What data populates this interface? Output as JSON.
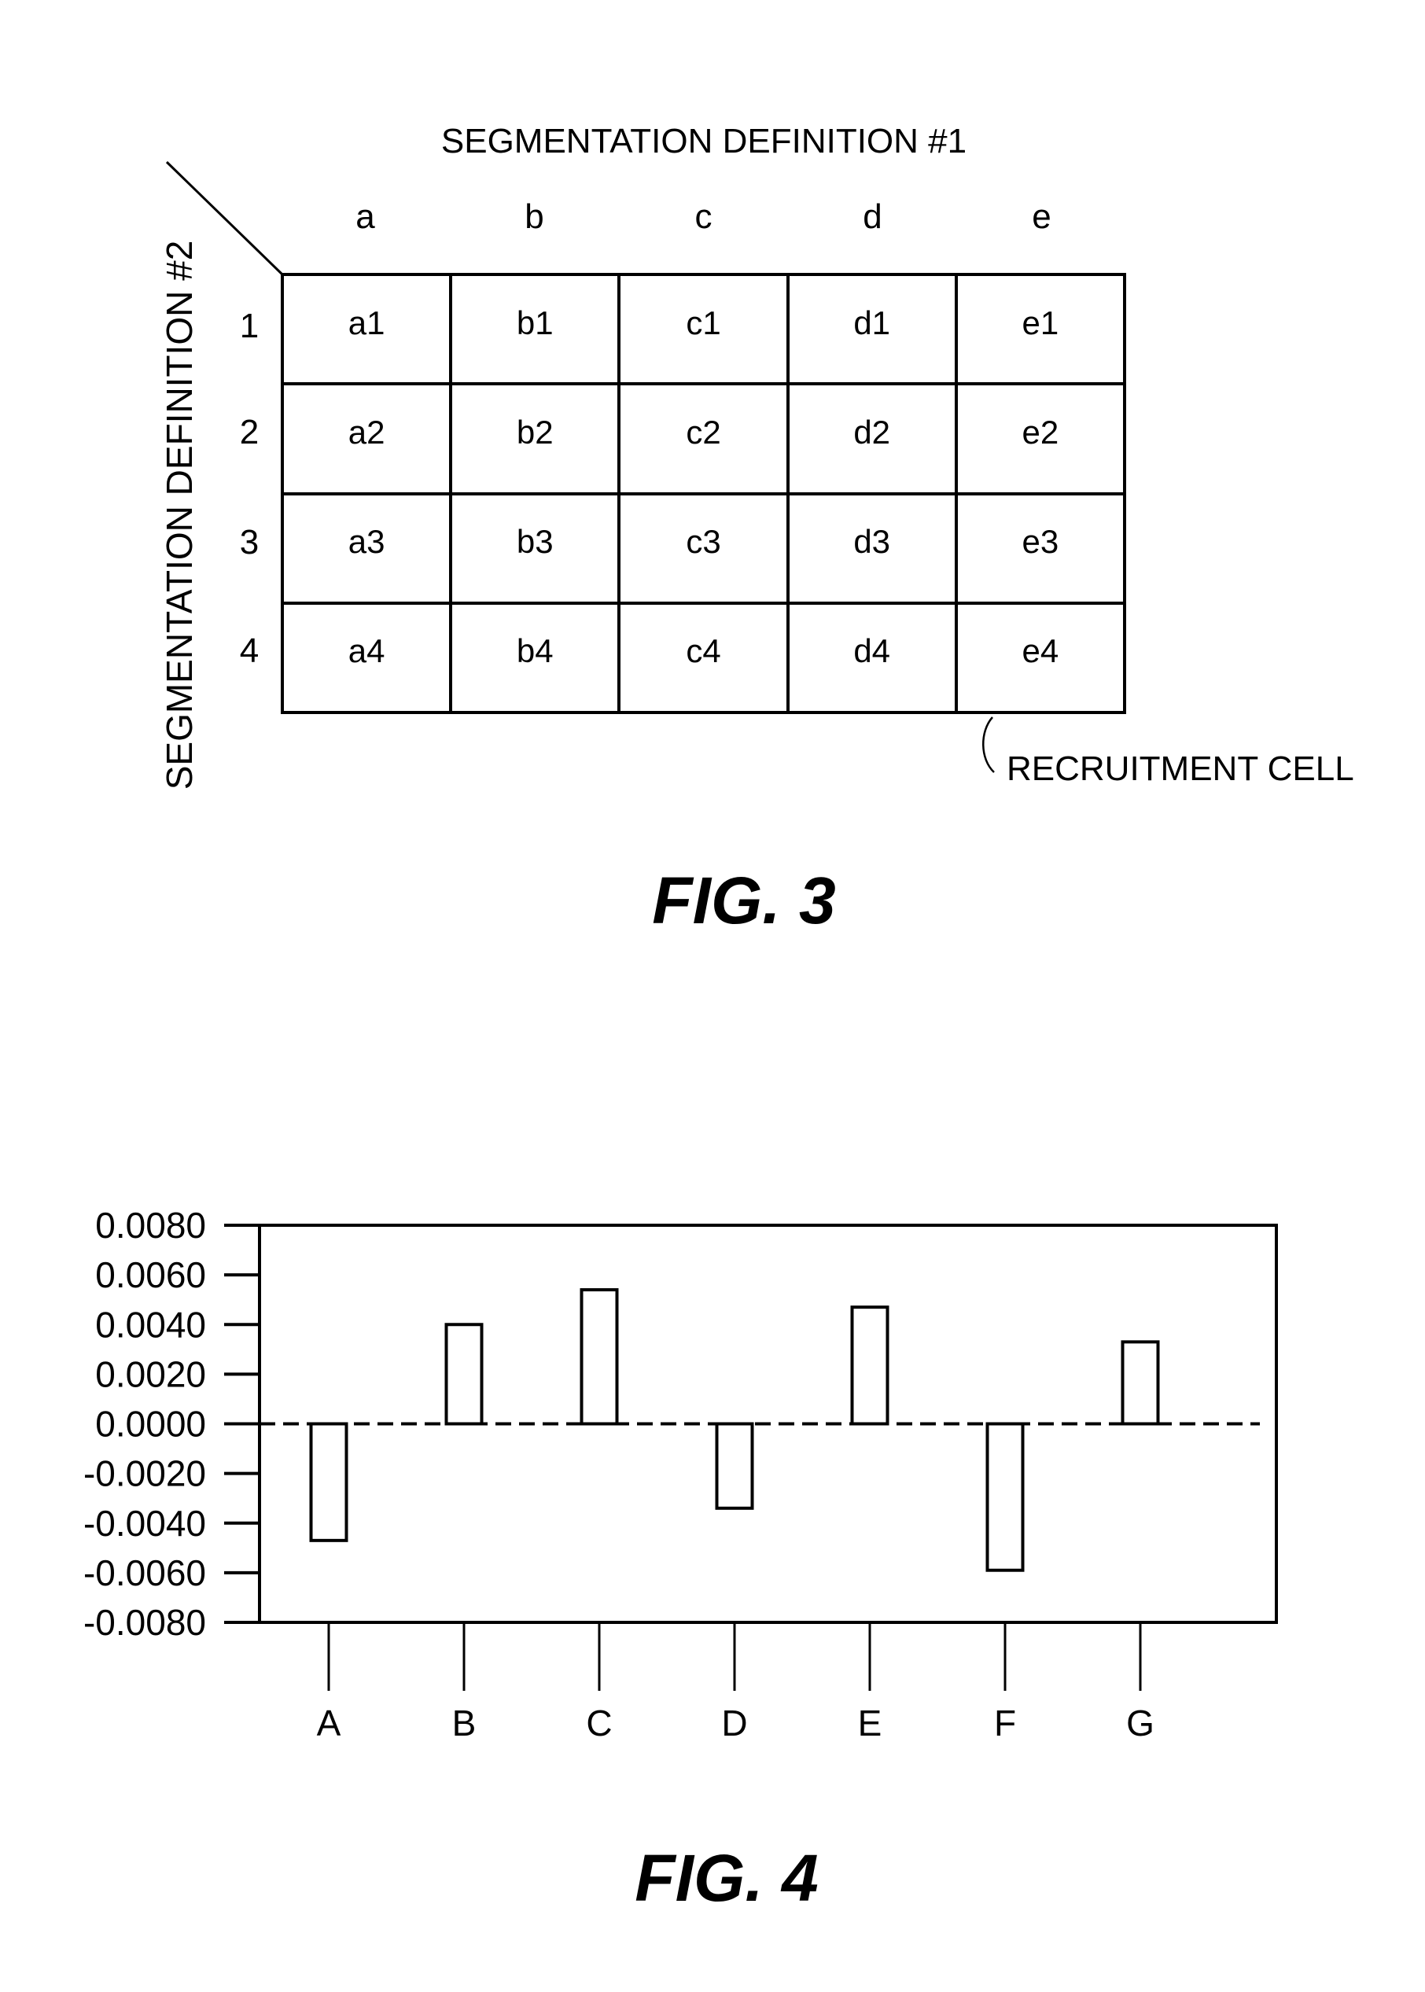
{
  "fig3": {
    "caption": "FIG. 3",
    "column_axis_title": "SEGMENTATION DEFINITION #1",
    "row_axis_title": "SEGMENTATION DEFINITION #2",
    "column_headers": [
      "a",
      "b",
      "c",
      "d",
      "e"
    ],
    "row_headers": [
      "1",
      "2",
      "3",
      "4"
    ],
    "cells": [
      [
        "a1",
        "b1",
        "c1",
        "d1",
        "e1"
      ],
      [
        "a2",
        "b2",
        "c2",
        "d2",
        "e2"
      ],
      [
        "a3",
        "b3",
        "c3",
        "d3",
        "e3"
      ],
      [
        "a4",
        "b4",
        "c4",
        "d4",
        "e4"
      ]
    ],
    "callout_label": "RECRUITMENT CELL"
  },
  "fig4": {
    "caption": "FIG. 4"
  },
  "chart_data": {
    "type": "bar",
    "title": "",
    "xlabel": "",
    "ylabel": "",
    "categories": [
      "A",
      "B",
      "C",
      "D",
      "E",
      "F",
      "G"
    ],
    "values": [
      -0.0047,
      0.004,
      0.0054,
      -0.0034,
      0.0047,
      -0.0059,
      0.0033
    ],
    "ylim": [
      -0.008,
      0.008
    ],
    "yticks": [
      0.008,
      0.006,
      0.004,
      0.002,
      0.0,
      -0.002,
      -0.004,
      -0.006,
      -0.008
    ],
    "ytick_labels": [
      "0.0080",
      "0.0060",
      "0.0040",
      "0.0020",
      "0.0000",
      "-0.0020",
      "-0.0040",
      "-0.0060",
      "-0.0080"
    ],
    "reference_line": {
      "value": 0.0,
      "style": "dashed"
    },
    "grid": false,
    "legend": "none",
    "bar_fill": "#ffffff",
    "bar_stroke": "#000000"
  }
}
